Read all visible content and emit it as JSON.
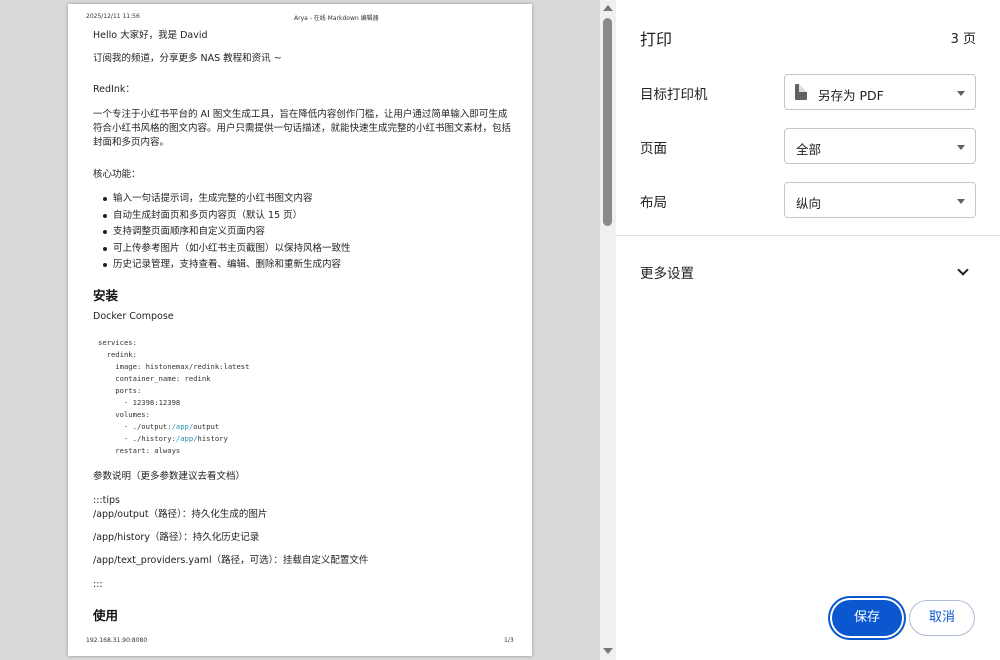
{
  "preview": {
    "header_left": "2025/12/11 11:56",
    "header_center": "Arya - 在线 Markdown 编辑器",
    "footer_left": "192.168.31.90:8080",
    "footer_right": "1/3",
    "lines": {
      "greeting": "Hello 大家好，我是 David",
      "subscribe": "订阅我的频道，分享更多 NAS 教程和资讯 ~",
      "redink_title": "RedInk：",
      "intro": "一个专注于小红书平台的 AI 图文生成工具，旨在降低内容创作门槛，让用户通过简单输入即可生成符合小红书风格的图文内容。用户只需提供一句话描述，就能快速生成完整的小红书图文素材，包括封面和多页内容。",
      "features_title": "核心功能：",
      "install_heading": "安装",
      "docker_compose": "Docker Compose",
      "params": "参数说明（更多参数建议去看文档）",
      "tips_open": ":::tips",
      "out_path": "/app/output（路径）：持久化生成的图片",
      "history_path": "/app/history（路径）：持久化历史记录",
      "providers_path": "/app/text_providers.yaml（路径，可选）：挂载自定义配置文件",
      "tips_close": ":::",
      "usage_heading": "使用"
    },
    "features": [
      "输入一句话提示词，生成完整的小红书图文内容",
      "自动生成封面页和多页内容页（默认 15 页）",
      "支持调整页面顺序和自定义页面内容",
      "可上传参考图片（如小红书主页截图）以保持风格一致性",
      "历史记录管理，支持查看、编辑、删除和重新生成内容"
    ],
    "code": {
      "l1": "services:",
      "l2": "  redink:",
      "l3": "    image: histonemax/redink:latest",
      "l4": "    container_name: redink",
      "l5": "    ports:",
      "l6": "      - 12398:12398",
      "l7": "    volumes:",
      "l8a": "      - ./output:",
      "l8b": "/app/",
      "l8c": "output",
      "l9a": "      - ./history:",
      "l9b": "/app/",
      "l9c": "history",
      "l10": "    restart: always",
      "accent_color": "#2a8fb0"
    }
  },
  "panel": {
    "title": "打印",
    "page_count": "3 页",
    "printer_label": "目标打印机",
    "printer_value": "另存为 PDF",
    "printer_icon": "pdf-document-icon",
    "pages_label": "页面",
    "pages_value": "全部",
    "layout_label": "布局",
    "layout_value": "纵向",
    "more_settings": "更多设置",
    "save_button": "保存",
    "cancel_button": "取消",
    "primary_color": "#0b57d0"
  }
}
